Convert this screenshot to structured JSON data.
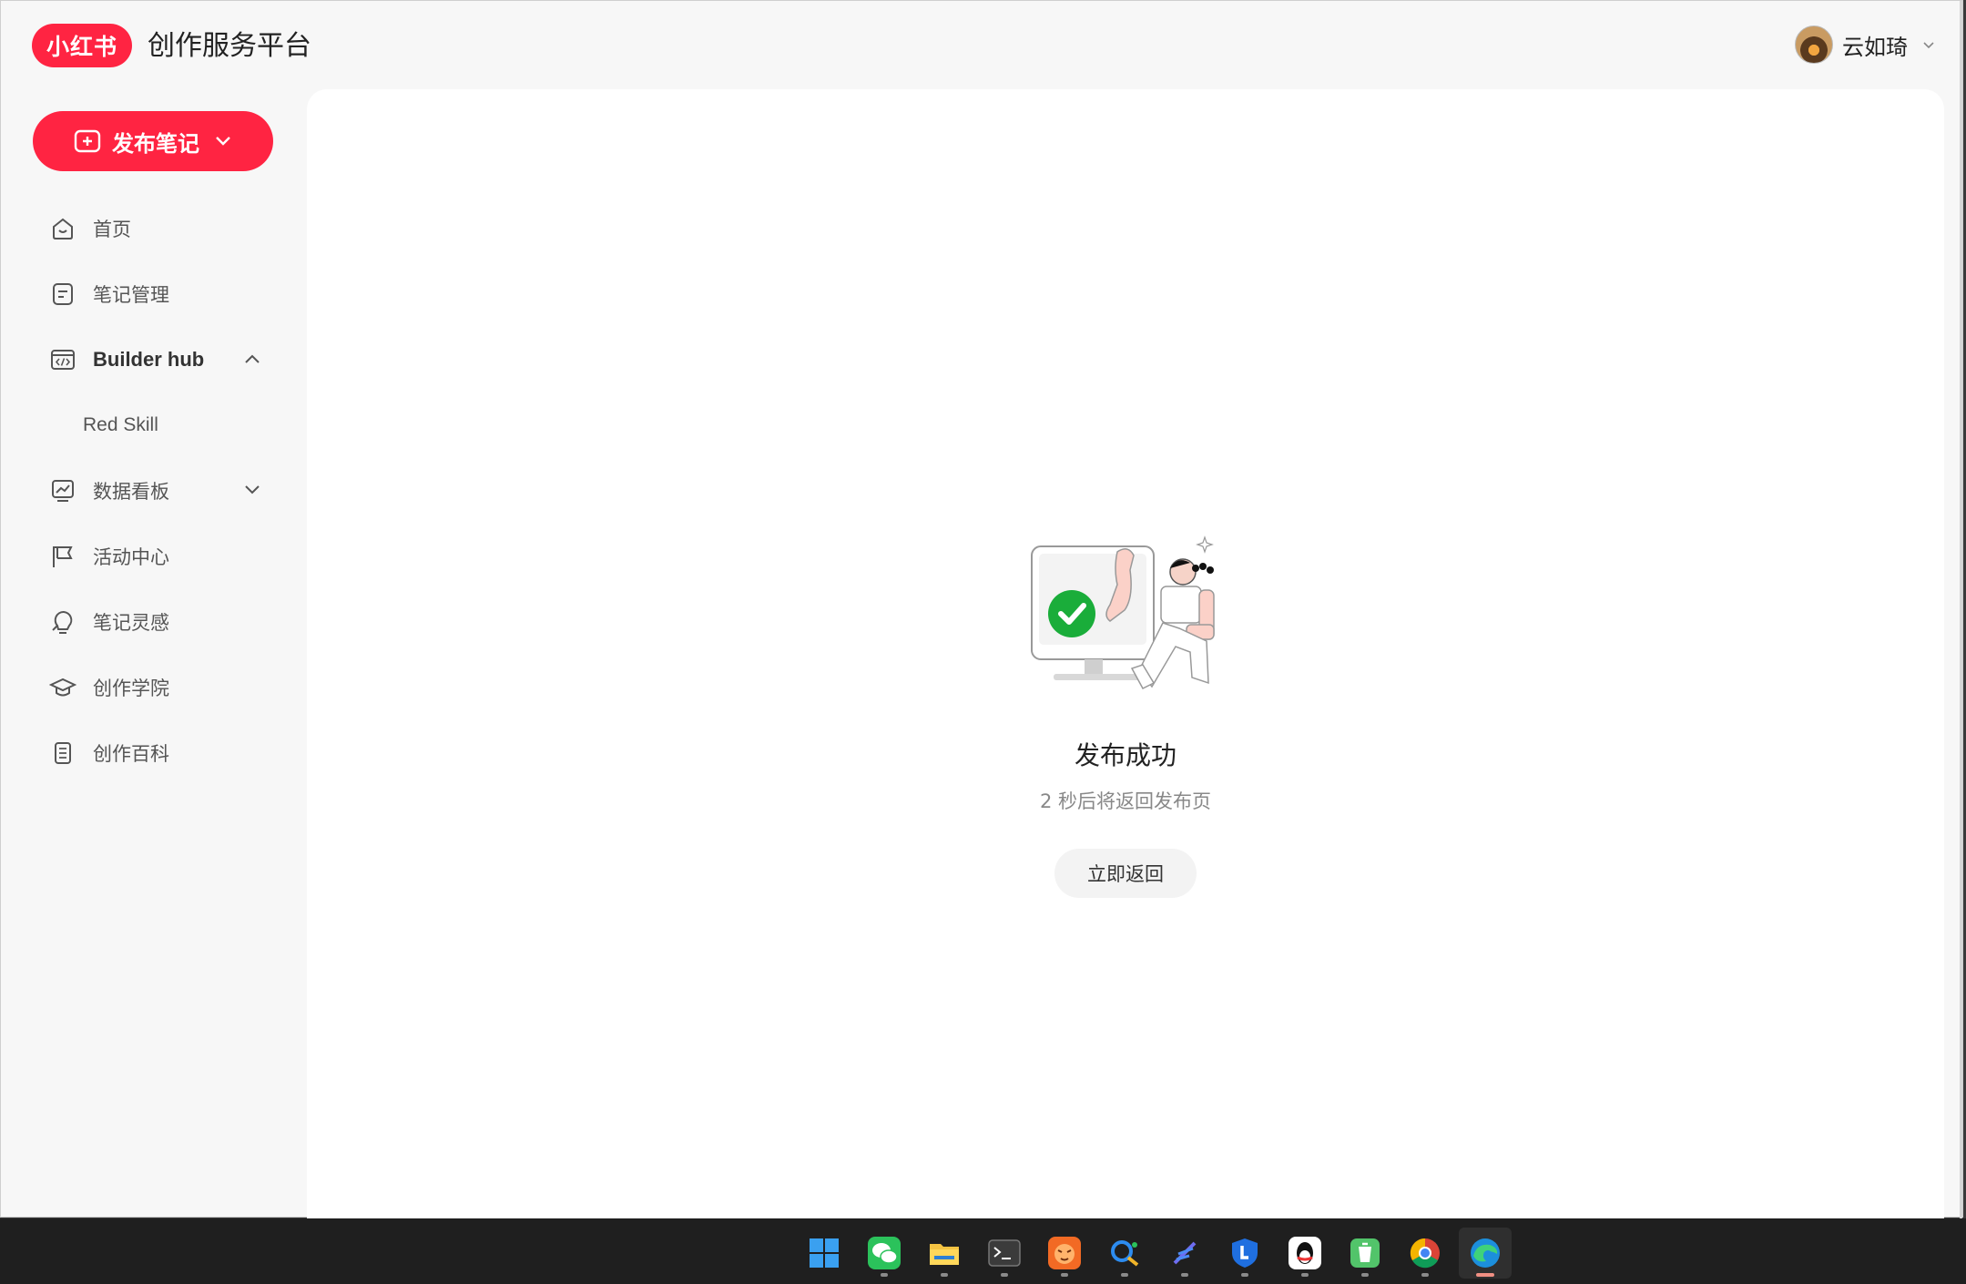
{
  "header": {
    "logo_text": "小红书",
    "platform_title": "创作服务平台",
    "user_name": "云如琦"
  },
  "sidebar": {
    "publish_label": "发布笔记",
    "items": [
      {
        "label": "首页",
        "icon": "home-icon"
      },
      {
        "label": "笔记管理",
        "icon": "note-icon"
      },
      {
        "label": "Builder hub",
        "icon": "code-window-icon",
        "expanded": true
      },
      {
        "label": "Red Skill",
        "sub": true
      },
      {
        "label": "数据看板",
        "icon": "chart-icon",
        "expanded": false
      },
      {
        "label": "活动中心",
        "icon": "flag-icon"
      },
      {
        "label": "笔记灵感",
        "icon": "bulb-icon"
      },
      {
        "label": "创作学院",
        "icon": "graduation-cap-icon"
      },
      {
        "label": "创作百科",
        "icon": "book-icon"
      }
    ]
  },
  "main": {
    "success_title": "发布成功",
    "success_subtitle": "2 秒后将返回发布页",
    "return_button": "立即返回"
  },
  "taskbar": {
    "apps": [
      "windows-start-icon",
      "wechat-icon",
      "file-explorer-icon",
      "terminal-icon",
      "tiger-app-icon",
      "search-app-icon",
      "feather-app-icon",
      "shield-app-icon",
      "qq-icon",
      "recycle-icon",
      "chrome-icon",
      "edge-icon"
    ],
    "active": "edge-icon"
  },
  "colors": {
    "brand": "#ff2442",
    "success": "#1aad3a"
  }
}
